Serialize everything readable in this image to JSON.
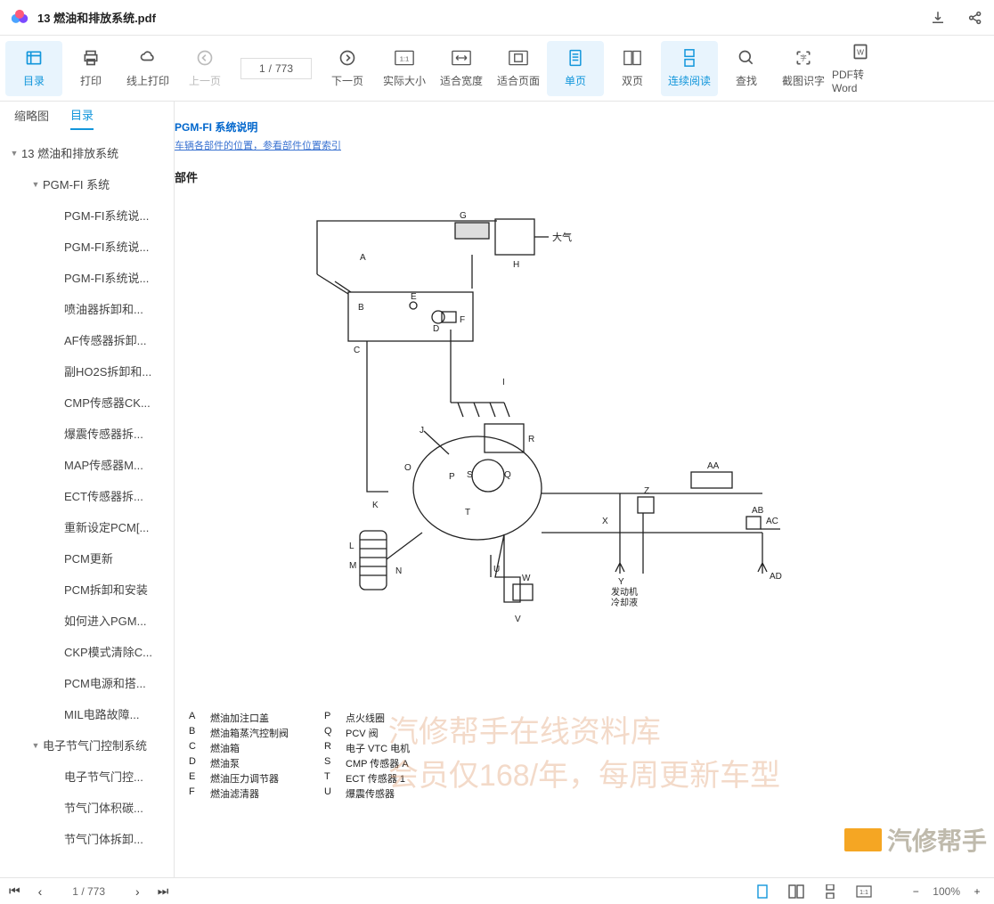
{
  "titleBar": {
    "title": "13 燃油和排放系统.pdf"
  },
  "toolbar": {
    "toc": "目录",
    "print": "打印",
    "online_print": "线上打印",
    "prev_page": "上一页",
    "page_current": "1",
    "page_sep": "/",
    "page_total": "773",
    "next_page": "下一页",
    "actual_size": "实际大小",
    "fit_width": "适合宽度",
    "fit_page": "适合页面",
    "single_page": "单页",
    "double_page": "双页",
    "continuous": "连续阅读",
    "search": "查找",
    "ocr": "截图识字",
    "to_word": "PDF转Word"
  },
  "sideTabs": {
    "thumbnail": "缩略图",
    "toc": "目录"
  },
  "tree": {
    "n0": "13 燃油和排放系统",
    "n1": "PGM-FI 系统",
    "n1_0": "PGM-FI系统说...",
    "n1_1": "PGM-FI系统说...",
    "n1_2": "PGM-FI系统说...",
    "n1_3": "喷油器拆卸和...",
    "n1_4": "AF传感器拆卸...",
    "n1_5": "副HO2S拆卸和...",
    "n1_6": "CMP传感器CK...",
    "n1_7": "爆震传感器拆...",
    "n1_8": "MAP传感器M...",
    "n1_9": "ECT传感器拆...",
    "n1_10": "重新设定PCM[...",
    "n1_11": "PCM更新",
    "n1_12": "PCM拆卸和安装",
    "n1_13": "如何进入PGM...",
    "n1_14": "CKP模式清除C...",
    "n1_15": "PCM电源和搭...",
    "n1_16": "MIL电路故障...",
    "n2": "电子节气门控制系统",
    "n2_0": "电子节气门控...",
    "n2_1": "节气门体积碳...",
    "n2_2": "节气门体拆卸..."
  },
  "doc": {
    "title": "PGM-FI 系统说明",
    "link": "车辆各部件的位置，参看部件位置索引",
    "sub": "部件",
    "diagram": {
      "atmos": "大气",
      "engine_coolant": "发动机\n冷却液"
    },
    "legend": {
      "left": [
        {
          "k": "A",
          "v": "燃油加注口盖"
        },
        {
          "k": "B",
          "v": "燃油箱蒸汽控制阀"
        },
        {
          "k": "C",
          "v": "燃油箱"
        },
        {
          "k": "D",
          "v": "燃油泵"
        },
        {
          "k": "E",
          "v": "燃油压力调节器"
        },
        {
          "k": "F",
          "v": "燃油滤清器"
        }
      ],
      "right": [
        {
          "k": "P",
          "v": "点火线圈"
        },
        {
          "k": "Q",
          "v": "PCV 阀"
        },
        {
          "k": "R",
          "v": "电子 VTC 电机"
        },
        {
          "k": "S",
          "v": "CMP 传感器 A"
        },
        {
          "k": "T",
          "v": "ECT 传感器 1"
        },
        {
          "k": "U",
          "v": "爆震传感器"
        }
      ]
    },
    "watermark_line1": "汽修帮手在线资料库",
    "watermark_line2": "会员仅168/年，每周更新车型",
    "watermark_logo": "汽修帮手"
  },
  "bottomBar": {
    "page_current": "1",
    "page_sep": "/",
    "page_total": "773",
    "zoom": "100%"
  }
}
